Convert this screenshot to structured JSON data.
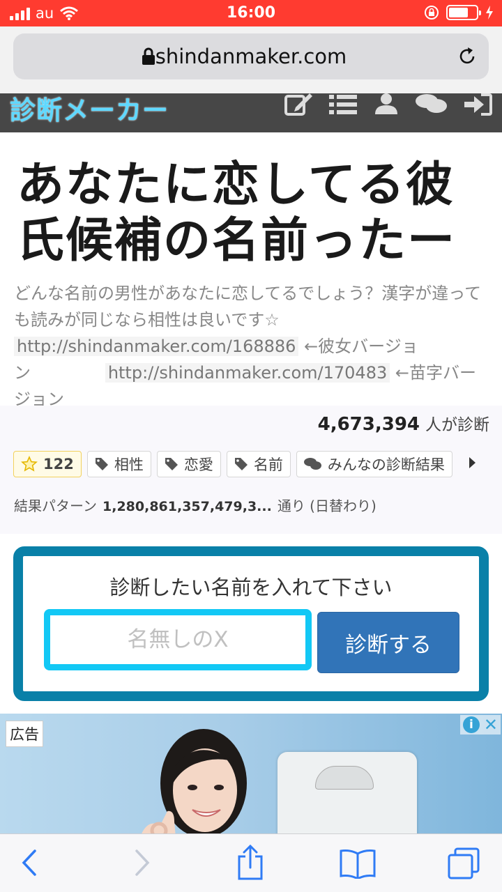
{
  "status_bar": {
    "carrier": "au",
    "time": "16:00"
  },
  "browser": {
    "url": "shindanmaker.com"
  },
  "site": {
    "logo": "診断メーカー"
  },
  "page": {
    "title": "あなたに恋してる彼氏候補の名前ったー",
    "description_text": "どんな名前の男性があなたに恋してるでしょう？漢字が違っても読みが同じなら相性は良いです☆",
    "link1": "http://shindanmaker.com/168886",
    "link1_suffix": "←彼女バージョン",
    "link2": "http://shindanmaker.com/170483",
    "link2_suffix": "←苗字バージョン"
  },
  "stats": {
    "count": "4,673,394",
    "count_suffix": "人が診断",
    "favorites": "122",
    "tags": [
      "相性",
      "恋愛",
      "名前"
    ],
    "results_link": "みんなの診断結果",
    "pattern_label": "結果パターン",
    "pattern_number": "1,280,861,357,479,3...",
    "pattern_suffix": "通り (日替わり)"
  },
  "form": {
    "label": "診断したい名前を入れて下さい",
    "placeholder": "名無しのX",
    "submit": "診断する"
  },
  "ad": {
    "label": "広告",
    "info": "i",
    "close": "✕"
  },
  "colors": {
    "status_bar": "#ff3b30",
    "header": "#474747",
    "logo": "#5fd8ff",
    "form_border": "#0980a8",
    "input_border": "#12c8f5",
    "button": "#3174b8",
    "toolbar_icon": "#2f7bf5"
  }
}
